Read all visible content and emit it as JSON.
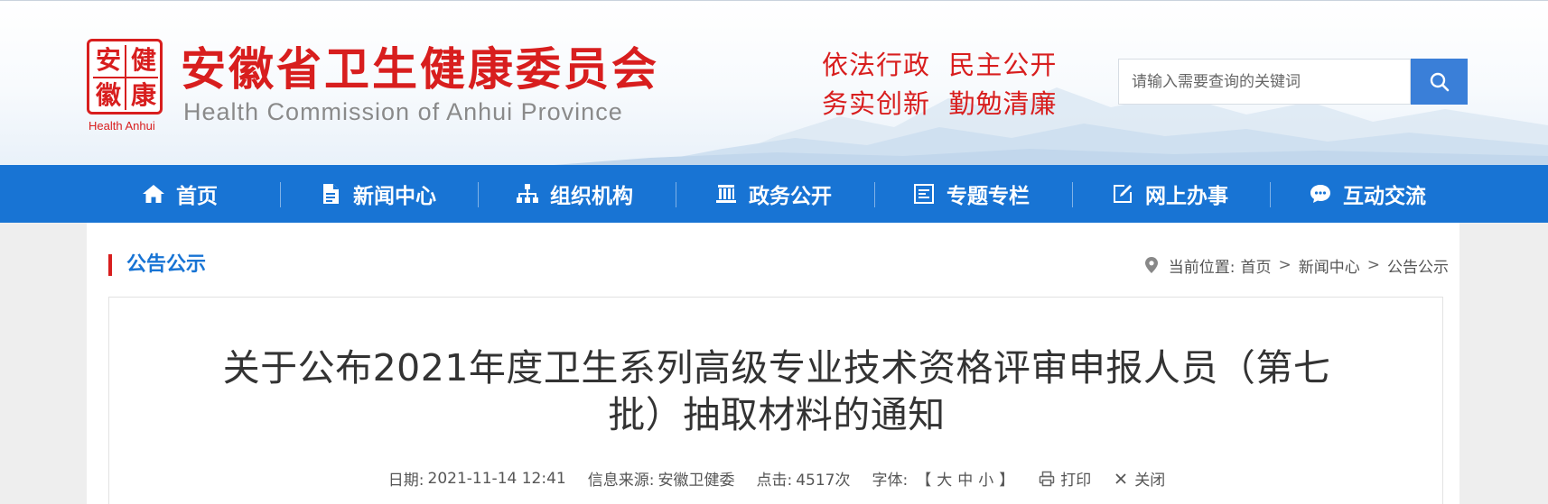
{
  "header": {
    "logo_chars": [
      "安",
      "健",
      "徽",
      "康"
    ],
    "logo_sub": "Health Anhui",
    "site_title": "安徽省卫生健康委员会",
    "site_title_en": "Health Commission of Anhui Province",
    "slogan_line1": "依法行政  民主公开",
    "slogan_line2": "务实创新  勤勉清廉",
    "search": {
      "placeholder": "请输入需要查询的关键词",
      "value": "",
      "button_icon": "search-icon"
    }
  },
  "nav": {
    "items": [
      {
        "label": "首页",
        "icon": "home-icon"
      },
      {
        "label": "新闻中心",
        "icon": "document-icon"
      },
      {
        "label": "组织机构",
        "icon": "org-chart-icon"
      },
      {
        "label": "政务公开",
        "icon": "building-icon"
      },
      {
        "label": "专题专栏",
        "icon": "list-box-icon"
      },
      {
        "label": "网上办事",
        "icon": "edit-icon"
      },
      {
        "label": "互动交流",
        "icon": "chat-icon"
      }
    ]
  },
  "section": {
    "title": "公告公示"
  },
  "breadcrumb": {
    "prefix": "当前位置:",
    "items": [
      "首页",
      "新闻中心",
      "公告公示"
    ],
    "separator": ">"
  },
  "article": {
    "title_line1": "关于公布2021年度卫生系列高级专业技术资格评审申报人员（第七",
    "title_line2": "批）抽取材料的通知",
    "meta": {
      "date_label": "日期:",
      "date": "2021-11-14 12:41",
      "source_label": "信息来源:",
      "source": "安徽卫健委",
      "clicks_label": "点击:",
      "clicks": "4517次",
      "font_label": "字体:",
      "bracket_open": "【",
      "font_large": "大",
      "font_medium": "中",
      "font_small": "小",
      "bracket_close": "】",
      "print_label": "打印",
      "close_label": "关闭"
    }
  },
  "colors": {
    "brand_red": "#d81e1e",
    "nav_blue": "#1874d4",
    "search_blue": "#3a7fd8"
  }
}
